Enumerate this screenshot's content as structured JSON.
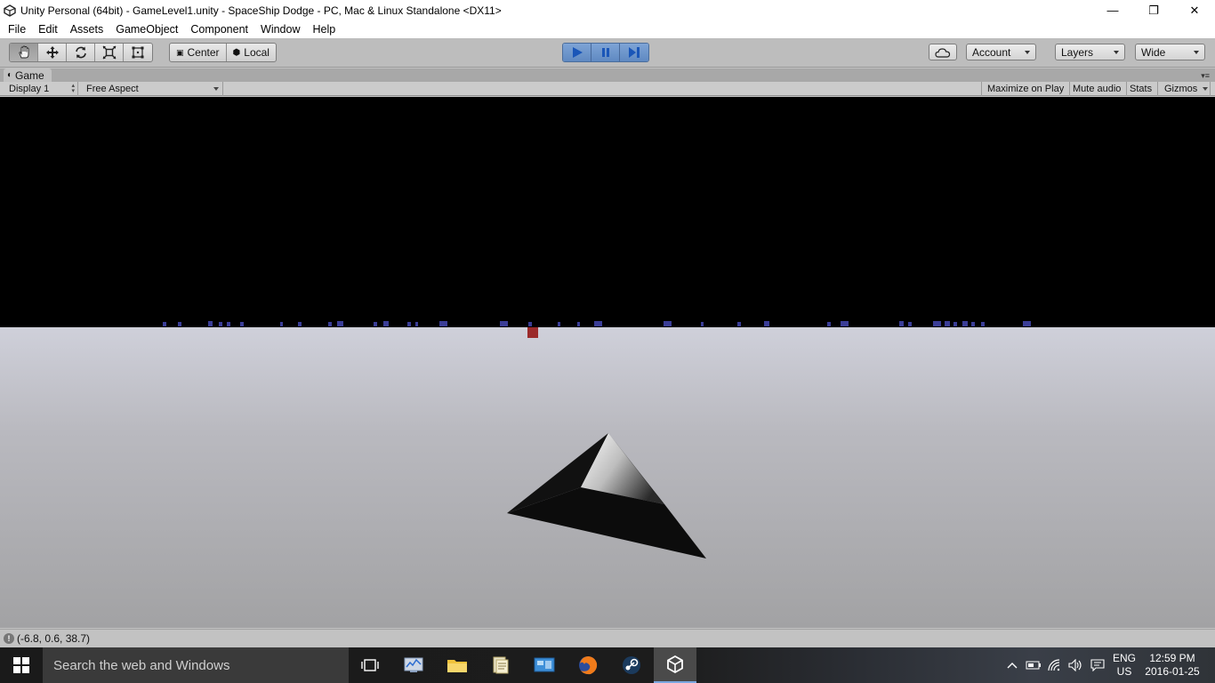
{
  "window": {
    "title": "Unity Personal (64bit) - GameLevel1.unity - SpaceShip Dodge - PC, Mac & Linux Standalone <DX11>",
    "minimize": "—",
    "maximize": "❐",
    "close": "✕"
  },
  "menu": {
    "items": [
      "File",
      "Edit",
      "Assets",
      "GameObject",
      "Component",
      "Window",
      "Help"
    ]
  },
  "toolbar": {
    "transform_tools": [
      "hand-tool",
      "move-tool",
      "rotate-tool",
      "scale-tool",
      "rect-tool"
    ],
    "active_tool": "hand-tool",
    "pivot_label": "Center",
    "space_label": "Local",
    "play_state": "playing",
    "account_label": "Account",
    "layers_label": "Layers",
    "layout_label": "Wide"
  },
  "game_panel": {
    "tab_label": "Game",
    "display_label": "Display 1",
    "aspect_label": "Free Aspect",
    "maximize_label": "Maximize on Play",
    "mute_label": "Mute audio",
    "stats_label": "Stats",
    "gizmos_label": "Gizmos"
  },
  "status": {
    "message": "(-6.8, 0.6, 38.7)"
  },
  "taskbar": {
    "search_placeholder": "Search the web and Windows",
    "language_line1": "ENG",
    "language_line2": "US",
    "time": "12:59 PM",
    "date": "2016-01-25"
  },
  "colors": {
    "sky": "#000000",
    "ground_top": "#c8c9d3",
    "ground_bottom": "#a4a4a6",
    "obstacle_blue": "#3a3d96",
    "obstacle_red": "#9b2a2a",
    "play_button": "#6a94cc"
  }
}
